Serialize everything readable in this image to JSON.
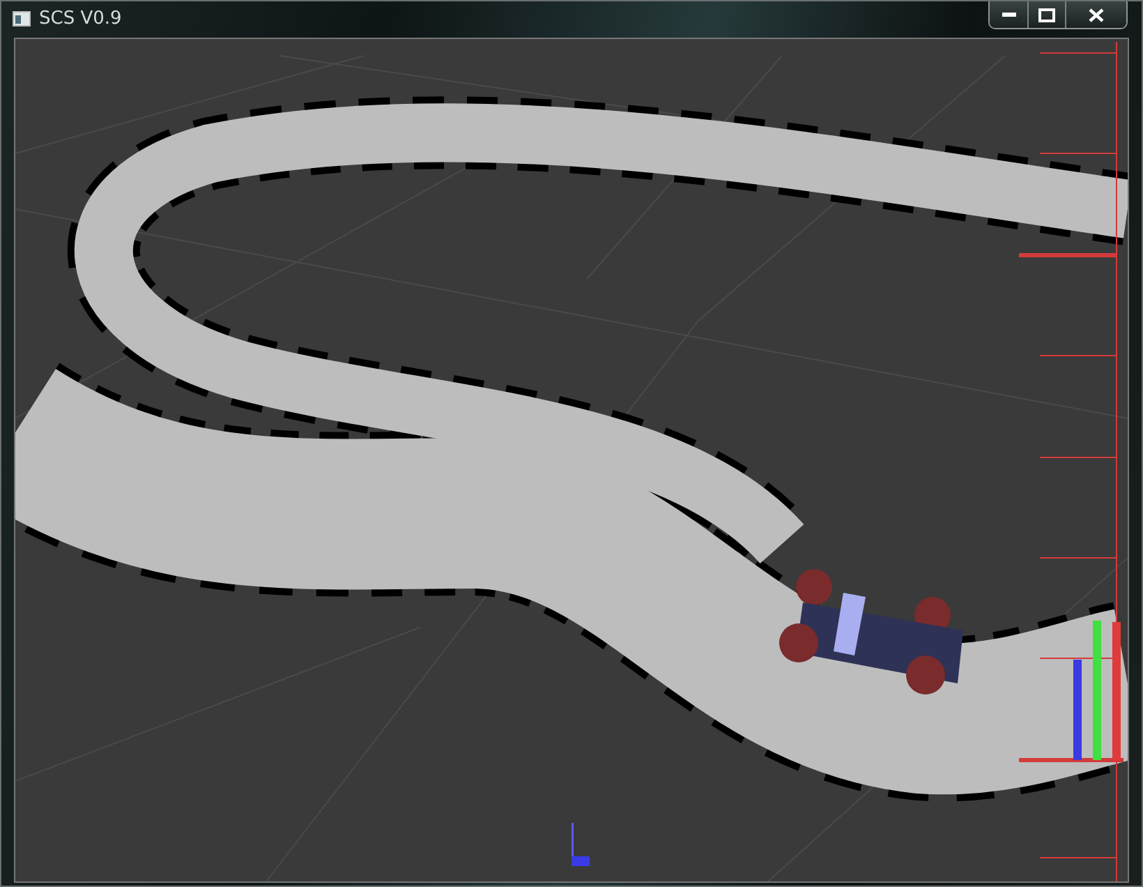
{
  "window": {
    "title": "SCS V0.9"
  }
}
